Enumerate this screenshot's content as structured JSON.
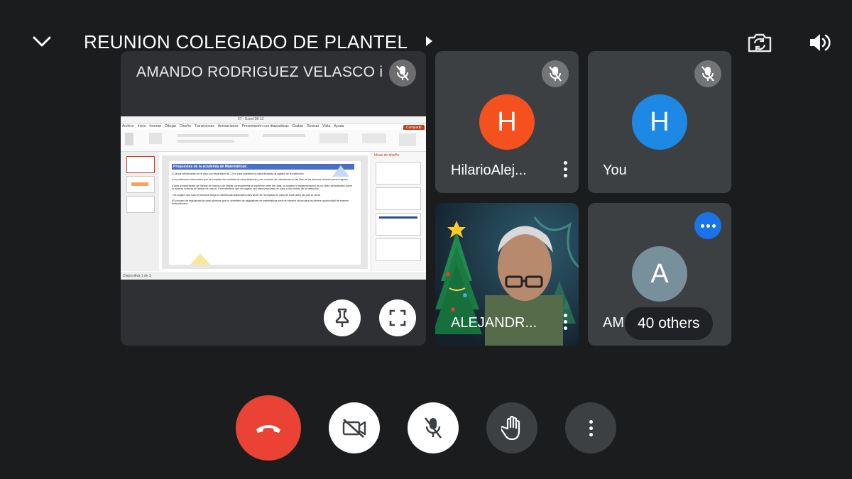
{
  "header": {
    "title": "REUNION COLEGIADO DE PLANTEL",
    "collapse_icon": "chevron-down-icon",
    "switch_camera_icon": "switch-camera-icon",
    "speaker_icon": "speaker-icon"
  },
  "main_tile": {
    "name": "AMANDO RODRIGUEZ VELASCO i",
    "muted": true,
    "slide": {
      "heading": "Propuestas de la academia de Matemáticas:",
      "bullets": [
        "•Colocar señalización en el piso con separación de 1.5 m para mantener la sana distancia al ingreso de la institución.",
        "•Los profesores observarán que se cumplan las medidas de sana distancia y uso correcto de cubrebocas en las filas de los alumnos durante previo ingreso",
        "•Dada la importancia del lavado de manos y de limpiar correctamente la superficie entre las uñas, se sugiere la implementación de un video demostrativo sobre la manera correcta de lavado de manos. Procedimiento que se sugiere sea observado tanto en casa como dentro de la institución",
        "• Se sugiere que todo el personal tenga 2 cubrebocas adicionales para servir de reemplazo en caso de sufrir daño del que se porta",
        "•El proceso de regularización para alumnos que no acrediten las asignaturas de matemáticas será de manera virtual para la primera oportunidad de examen extraordinario."
      ],
      "ribbon_tabs": [
        "Archivo",
        "Inicio",
        "Insertar",
        "Dibujar",
        "Diseño",
        "Transiciones",
        "Animaciones",
        "Presentación con diapositivas",
        "Grabar",
        "Revisar",
        "Vista",
        "Ayuda"
      ],
      "side_panel_title": "Ideas de diseño",
      "share_button": "Compartir",
      "window_title": "27 - Excel 28-12",
      "status_left": "Diapositiva 1 de 3"
    },
    "pin_icon": "pin-icon",
    "fullscreen_icon": "fullscreen-icon"
  },
  "participants": [
    {
      "name": "HilarioAlej...",
      "initial": "H",
      "color": "#f4511e",
      "muted": true
    },
    {
      "name": "You",
      "initial": "H",
      "color": "#1e88e5",
      "muted": true
    },
    {
      "name": "ALEJANDR...",
      "initial": "",
      "color": "#1c2e3e",
      "muted": false
    },
    {
      "name": "AM",
      "initial": "A",
      "color": "#78909c",
      "muted": false
    }
  ],
  "others_label": "40 others",
  "controls": {
    "hangup_icon": "hang-up-icon",
    "camera_icon": "camera-off-icon",
    "mic_icon": "mic-off-icon",
    "hand_icon": "raise-hand-icon",
    "more_icon": "more-vert-icon",
    "hangup_color": "#ea4335"
  }
}
